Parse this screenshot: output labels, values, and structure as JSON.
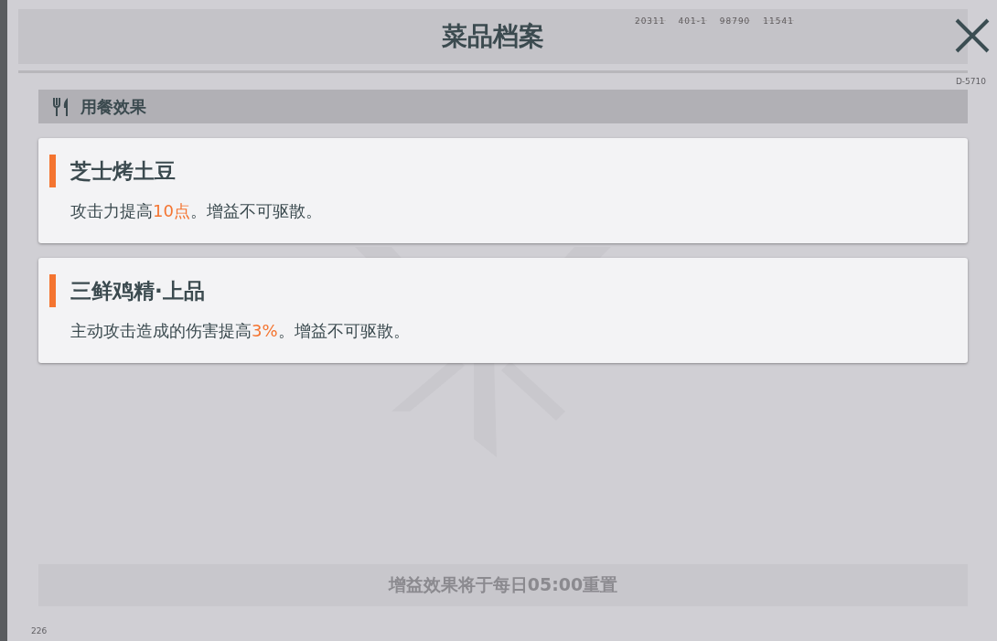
{
  "header": {
    "title": "菜品档案",
    "codes": [
      "20311",
      "401-1",
      "98790",
      "11541"
    ],
    "serial": "D-5710"
  },
  "section": {
    "title": "用餐效果"
  },
  "dishes": [
    {
      "name": "芝士烤土豆",
      "description": [
        {
          "text": "攻击力提高",
          "highlight": false
        },
        {
          "text": "10点",
          "highlight": true
        },
        {
          "text": "。增益不可驱散。",
          "highlight": false
        }
      ]
    },
    {
      "name": "三鲜鸡精·上品",
      "description": [
        {
          "text": "主动攻击造成的伤害提高",
          "highlight": false
        },
        {
          "text": "3%",
          "highlight": true
        },
        {
          "text": "。增益不可驱散。",
          "highlight": false
        }
      ]
    }
  ],
  "footer": {
    "note": "增益效果将于每日05:00重置",
    "corner": "226"
  }
}
